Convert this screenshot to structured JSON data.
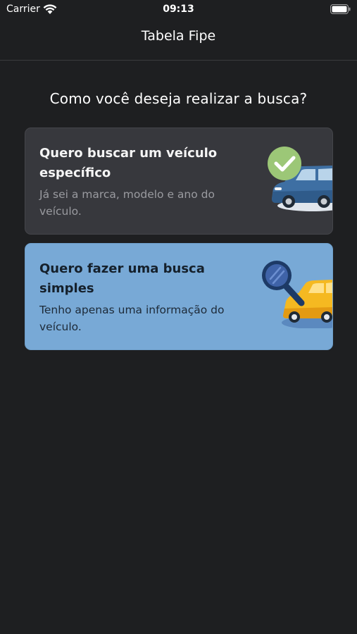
{
  "status_bar": {
    "carrier": "Carrier",
    "time": "09:13",
    "icons": [
      "wifi-icon",
      "battery-icon"
    ]
  },
  "nav": {
    "title": "Tabela Fipe"
  },
  "main": {
    "question": "Como você deseja realizar a busca?",
    "options": [
      {
        "title": "Quero buscar um veículo específico",
        "description": "Já sei a marca, modelo e ano do veículo.",
        "illustration": "blue-car-checkmark-icon",
        "background": "#37383d"
      },
      {
        "title": "Quero fazer uma busca simples",
        "description": "Tenho apenas uma informação do veículo.",
        "illustration": "yellow-car-magnifier-icon",
        "background": "#78a9d6"
      }
    ]
  },
  "colors": {
    "background": "#1e1f21",
    "accent_blue": "#78a9d6",
    "check_green": "#9cc777"
  }
}
